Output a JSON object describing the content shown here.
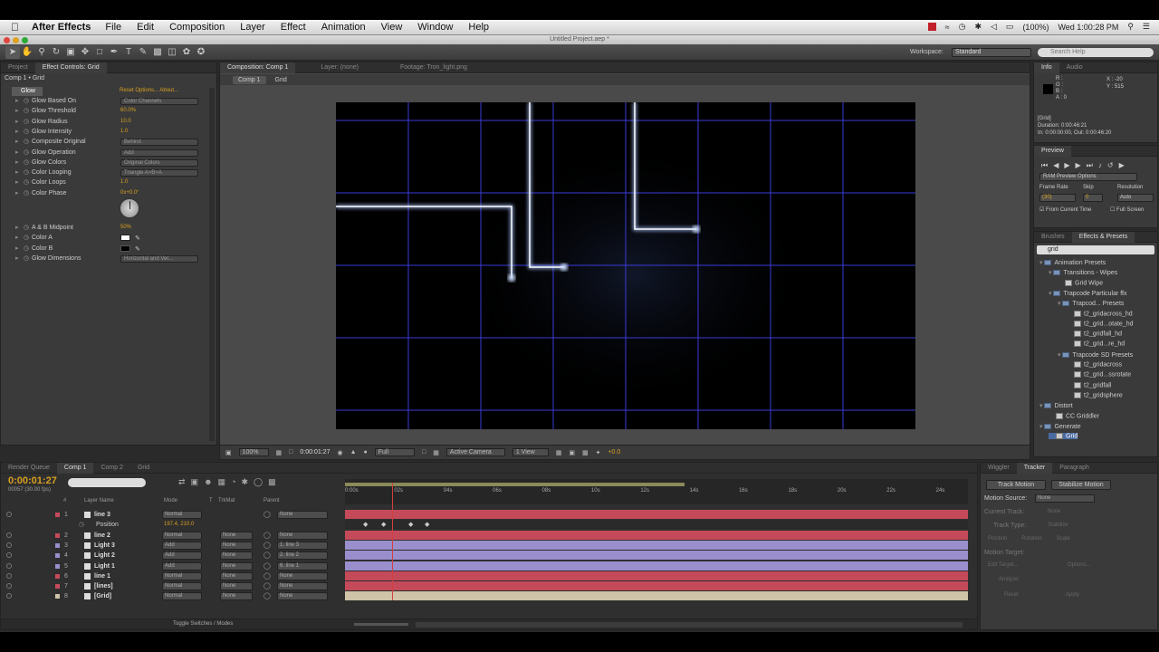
{
  "menubar": {
    "app_name": "After Effects",
    "items": [
      "File",
      "Edit",
      "Composition",
      "Layer",
      "Effect",
      "Animation",
      "View",
      "Window",
      "Help"
    ],
    "battery": "(100%)",
    "clock": "Wed 1:00:28 PM"
  },
  "window_title": "Untitled Project.aep *",
  "workspace": {
    "label": "Workspace:",
    "value": "Standard"
  },
  "search_help": {
    "placeholder": "Search Help"
  },
  "left_panel": {
    "tabs": [
      "Project",
      "Effect Controls: Grid"
    ],
    "breadcrumb": "Comp 1 • Grid",
    "effect_name": "Glow",
    "effect_links": "Reset  Options...  About...",
    "properties": [
      {
        "label": "Glow Based On",
        "value": "Color Channels",
        "kind": "dropdown"
      },
      {
        "label": "Glow Threshold",
        "value": "60.0%",
        "kind": "value"
      },
      {
        "label": "Glow Radius",
        "value": "10.0",
        "kind": "value"
      },
      {
        "label": "Glow Intensity",
        "value": "1.0",
        "kind": "value"
      },
      {
        "label": "Composite Original",
        "value": "Behind",
        "kind": "dropdown"
      },
      {
        "label": "Glow Operation",
        "value": "Add",
        "kind": "dropdown"
      },
      {
        "label": "Glow Colors",
        "value": "Original Colors",
        "kind": "dropdown"
      },
      {
        "label": "Color Looping",
        "value": "Triangle A>B>A",
        "kind": "dropdown"
      },
      {
        "label": "Color Loops",
        "value": "1.0",
        "kind": "value"
      },
      {
        "label": "Color Phase",
        "value": "0x+0.0°",
        "kind": "value"
      }
    ],
    "properties2": [
      {
        "label": "A & B Midpoint",
        "value": "50%",
        "kind": "value"
      },
      {
        "label": "Color A",
        "value": "",
        "kind": "swatch-white"
      },
      {
        "label": "Color B",
        "value": "",
        "kind": "swatch-black"
      },
      {
        "label": "Glow Dimensions",
        "value": "Horizontal and Ver...",
        "kind": "dropdown"
      }
    ]
  },
  "viewer": {
    "tabs": [
      "Composition: Comp 1",
      "Layer: (none)",
      "Footage: Tron_light.png"
    ],
    "breadcrumb": [
      "Comp 1",
      "Grid"
    ],
    "zoom": "100%",
    "timecode": "0:00:01:27",
    "resolution": "Full",
    "camera": "Active Camera",
    "views": "1 View",
    "exposure": "+0.0"
  },
  "right_panel": {
    "info_tabs": [
      "Info",
      "Audio"
    ],
    "info_rgb": [
      "R :",
      "G :",
      "B :",
      "A : 0"
    ],
    "info_xy": [
      "X : -20",
      "Y : 515"
    ],
    "info_layer": "[Grid]",
    "info_duration": "Duration: 0:00:46:21",
    "info_in_out": "In: 0:00:00:00, Out: 0:00:46:20",
    "preview_tab": "Preview",
    "ram_preview": "RAM Preview Options",
    "frame_rate_label": "Frame Rate",
    "skip_label": "Skip",
    "resolution_label": "Resolution",
    "frame_rate": "(30)",
    "skip": "0",
    "resolution": "Auto",
    "from_current": "From Current Time",
    "full_screen": "Full Screen",
    "effects_tabs": [
      "Brushes",
      "Effects & Presets"
    ],
    "effects_search": "grid",
    "tree": [
      {
        "label": "Animation Presets",
        "indent": 0,
        "folder": true
      },
      {
        "label": "Transitions - Wipes",
        "indent": 1,
        "folder": true
      },
      {
        "label": "Grid Wipe",
        "indent": 2,
        "folder": false
      },
      {
        "label": "Trapcode Particular ffx",
        "indent": 1,
        "folder": true
      },
      {
        "label": "Trapcod... Presets",
        "indent": 2,
        "folder": true
      },
      {
        "label": "t2_gridacross_hd",
        "indent": 3,
        "folder": false
      },
      {
        "label": "t2_grid...otate_hd",
        "indent": 3,
        "folder": false
      },
      {
        "label": "t2_gridfall_hd",
        "indent": 3,
        "folder": false
      },
      {
        "label": "t2_grid...re_hd",
        "indent": 3,
        "folder": false
      },
      {
        "label": "Trapcode SD Presets",
        "indent": 2,
        "folder": true
      },
      {
        "label": "t2_gridacross",
        "indent": 3,
        "folder": false
      },
      {
        "label": "t2_grid...ssrotate",
        "indent": 3,
        "folder": false
      },
      {
        "label": "t2_gridfall",
        "indent": 3,
        "folder": false
      },
      {
        "label": "t2_gridsphere",
        "indent": 3,
        "folder": false
      },
      {
        "label": "Distort",
        "indent": 0,
        "folder": true
      },
      {
        "label": "CC Griddler",
        "indent": 1,
        "folder": false
      },
      {
        "label": "Generate",
        "indent": 0,
        "folder": true
      },
      {
        "label": "Grid",
        "indent": 1,
        "folder": false
      }
    ]
  },
  "timeline": {
    "tabs": [
      "Render Queue",
      "Comp 1",
      "Comp 2",
      "Grid"
    ],
    "timecode": "0:00:01:27",
    "frame_info": "00057 (30.00 fps)",
    "columns": [
      "#",
      "Layer Name",
      "Mode",
      "T",
      "TrkMat",
      "Parent"
    ],
    "ruler": [
      "0:00s",
      "02s",
      "04s",
      "06s",
      "08s",
      "10s",
      "12s",
      "14s",
      "16s",
      "18s",
      "20s",
      "22s",
      "24s"
    ],
    "playhead": 1.9,
    "layers": [
      {
        "num": "1",
        "name": "line 3",
        "mode": "Normal",
        "trkmat": "",
        "parent": "None",
        "color": "#c44a5a"
      },
      {
        "num": "",
        "name": "Position",
        "mode": "197.4, 210.0",
        "trkmat": "",
        "parent": "",
        "color": ""
      },
      {
        "num": "2",
        "name": "line 2",
        "mode": "Normal",
        "trkmat": "None",
        "parent": "None",
        "color": "#c44a5a"
      },
      {
        "num": "3",
        "name": "Light 3",
        "mode": "Add",
        "trkmat": "None",
        "parent": "1. line 3",
        "color": "#9a8fcc"
      },
      {
        "num": "4",
        "name": "Light 2",
        "mode": "Add",
        "trkmat": "None",
        "parent": "2. line 2",
        "color": "#9a8fcc"
      },
      {
        "num": "5",
        "name": "Light 1",
        "mode": "Add",
        "trkmat": "None",
        "parent": "6. line 1",
        "color": "#9a8fcc"
      },
      {
        "num": "6",
        "name": "line 1",
        "mode": "Normal",
        "trkmat": "None",
        "parent": "None",
        "color": "#c44a5a"
      },
      {
        "num": "7",
        "name": "[lines]",
        "mode": "Normal",
        "trkmat": "None",
        "parent": "None",
        "color": "#c44a5a"
      },
      {
        "num": "8",
        "name": "[Grid]",
        "mode": "Normal",
        "trkmat": "None",
        "parent": "None",
        "color": "#cfc3a8"
      }
    ],
    "footer": "Toggle Switches / Modes"
  },
  "tracker": {
    "tabs": [
      "Wiggler",
      "Tracker",
      "Paragraph"
    ],
    "track_motion": "Track Motion",
    "stabilize": "Stabilize Motion",
    "motion_source_label": "Motion Source:",
    "motion_source": "None",
    "current_track_label": "Current Track:",
    "current_track": "None",
    "track_type_label": "Track Type:",
    "track_type": "Stabilize",
    "checks": [
      "Position",
      "Rotation",
      "Scale"
    ],
    "motion_target": "Motion Target:",
    "edit_target": "Edit Target...",
    "options": "Options...",
    "analyze": "Analyze:",
    "reset": "Reset",
    "apply": "Apply"
  }
}
